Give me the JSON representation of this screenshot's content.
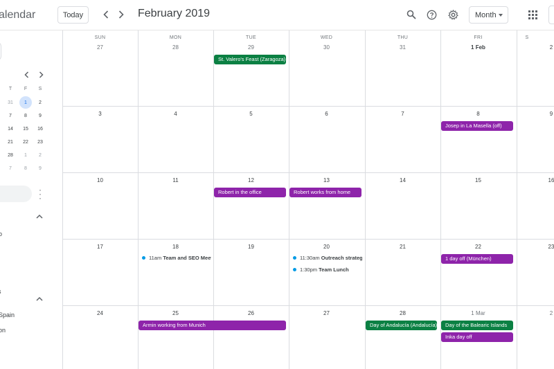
{
  "header": {
    "app_title": "alendar",
    "today_label": "Today",
    "prev_label": "‹",
    "next_label": "›",
    "month_title": "February 2019",
    "view_label": "Month"
  },
  "icons": {
    "search": "search-icon",
    "help": "help-icon",
    "settings": "gear-icon",
    "apps": "apps-grid-icon"
  },
  "colors": {
    "event_green": "#0b8043",
    "event_purple": "#8e24aa",
    "task_dot": "#039be5",
    "selected_day_bg": "#d2e3fc"
  },
  "mini_calendar": {
    "prev": "‹",
    "next": "›",
    "headers": [
      "T",
      "F",
      "S"
    ],
    "rows": [
      [
        "31",
        "1",
        "2"
      ],
      [
        "7",
        "8",
        "9"
      ],
      [
        "14",
        "15",
        "16"
      ],
      [
        "21",
        "22",
        "23"
      ],
      [
        "28",
        "1",
        "2"
      ],
      [
        "7",
        "8",
        "9"
      ]
    ],
    "selected": "1"
  },
  "sidebar": {
    "section1_text": "o",
    "section2_items": [
      "Spain",
      "on"
    ],
    "section2_header": "s"
  },
  "days_of_week": [
    "SUN",
    "MON",
    "TUE",
    "WED",
    "THU",
    "FRI",
    "S"
  ],
  "weeks": [
    [
      "27",
      "28",
      "29",
      "30",
      "31",
      "1 Feb",
      "2"
    ],
    [
      "3",
      "4",
      "5",
      "6",
      "7",
      "8",
      "9"
    ],
    [
      "10",
      "11",
      "12",
      "13",
      "14",
      "15",
      "16"
    ],
    [
      "17",
      "18",
      "19",
      "20",
      "21",
      "22",
      "23"
    ],
    [
      "24",
      "25",
      "26",
      "27",
      "28",
      "1 Mar",
      "2"
    ]
  ],
  "events": {
    "w1_tue": "St. Valero's Feast (Zaragoza)",
    "w2_fri": "Josep in La Masella (off)",
    "w3_tue": "Robert in the office",
    "w3_wed": "Robert works from home",
    "w4_mon_time": "11am",
    "w4_mon_title": "Team and SEO Meeting",
    "w4_wed1_time": "11:30am",
    "w4_wed1_title": "Outreach strategy",
    "w4_wed2_time": "1:30pm",
    "w4_wed2_title": "Team Lunch",
    "w4_fri": "1 day off (München)",
    "w5_mon_tue": "Armin working from Munich",
    "w5_thu": "Day of Andalucía (Andalucía)",
    "w5_fri1": "Day of the Balearic Islands",
    "w5_fri2": "Inka day off"
  }
}
